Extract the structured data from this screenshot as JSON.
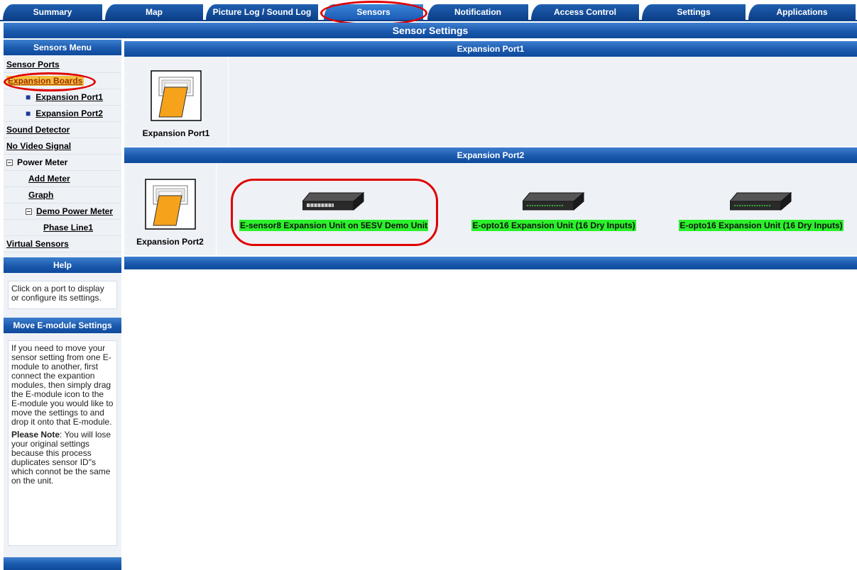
{
  "tabs": [
    {
      "label": "Summary"
    },
    {
      "label": "Map"
    },
    {
      "label": "Picture Log / Sound Log"
    },
    {
      "label": "Sensors"
    },
    {
      "label": "Notification"
    },
    {
      "label": "Access Control"
    },
    {
      "label": "Settings"
    },
    {
      "label": "Applications"
    }
  ],
  "active_tab": "Sensors",
  "page_title": "Sensor Settings",
  "sidebar": {
    "menu_title": "Sensors Menu",
    "items": [
      {
        "label": "Sensor Ports"
      },
      {
        "label": "Expansion Boards"
      },
      {
        "label": "Expansion Port1"
      },
      {
        "label": "Expansion Port2"
      },
      {
        "label": "Sound Detector"
      },
      {
        "label": "No Video Signal"
      },
      {
        "label": "Power Meter"
      },
      {
        "label": "Add Meter"
      },
      {
        "label": "Graph"
      },
      {
        "label": "Demo Power Meter"
      },
      {
        "label": "Phase Line1"
      },
      {
        "label": "Virtual Sensors"
      }
    ],
    "help_title": "Help",
    "help_text": "Click on a port to display or configure its settings.",
    "move_title": "Move E-module Settings",
    "move_text": "If you need to move your sensor setting from one E-module to another, first connect the expantion modules, then simply drag the E-module icon to the E-module you would like to move the settings to and drop it onto that E-module.",
    "note_label": "Please Note",
    "note_text": ": You will lose your original settings because this process duplicates sensor ID\"s which connot be the same on the unit."
  },
  "port1": {
    "title": "Expansion Port1",
    "port_label": "Expansion Port1"
  },
  "port2": {
    "title": "Expansion Port2",
    "port_label": "Expansion Port2",
    "units": [
      {
        "label": "E-sensor8 Expansion Unit on 5ESV Demo Unit"
      },
      {
        "label": "E-opto16 Expansion Unit (16 Dry Inputs)"
      },
      {
        "label": "E-opto16 Expansion Unit (16 Dry Inputs)"
      }
    ]
  },
  "colors": {
    "tab_blue": "#0c3f88",
    "bar_blue": "#1a59ad",
    "highlight_red": "#e00000",
    "unit_label_green": "#2cf02c",
    "panel_bg": "#eef2f7"
  },
  "icons": [
    "expansion-port-icon",
    "expansion-unit-icon",
    "minus-box-icon"
  ]
}
